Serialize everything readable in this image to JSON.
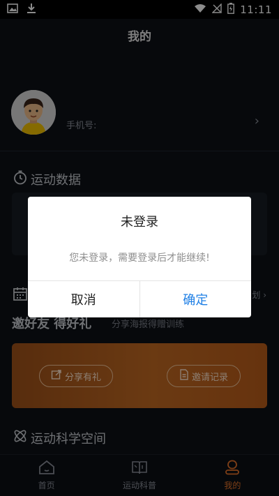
{
  "status_bar": {
    "time": "11:11"
  },
  "header": {
    "title": "我的"
  },
  "profile": {
    "phone_label": "手机号:"
  },
  "sections": {
    "sport_data": "运动数据",
    "invite_more": "划 ›",
    "invite_title": "邀好友 得好礼",
    "invite_subtitle": "分享海报得赠训练",
    "share_button": "分享有礼",
    "record_button": "邀请记录",
    "science_space": "运动科学空间"
  },
  "tabs": [
    {
      "label": "首页",
      "icon": "home-icon"
    },
    {
      "label": "运动科普",
      "icon": "book-icon"
    },
    {
      "label": "我的",
      "icon": "profile-icon"
    }
  ],
  "dialog": {
    "title": "未登录",
    "message": "您未登录，需要登录后才能继续!",
    "cancel": "取消",
    "confirm": "确定"
  },
  "colors": {
    "accent": "#e8742a",
    "confirm": "#1f7fe5",
    "background": "#0d1117"
  }
}
